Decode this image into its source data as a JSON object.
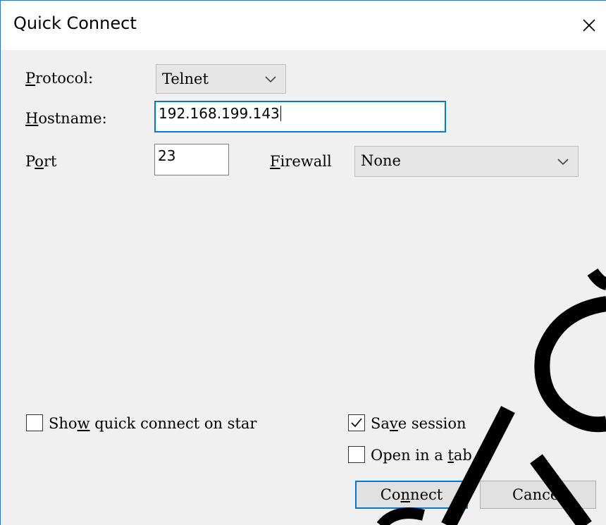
{
  "window": {
    "title": "Quick Connect"
  },
  "form": {
    "protocol_label_pre": "",
    "protocol_label_ul": "P",
    "protocol_label_post": "rotocol:",
    "protocol_value": "Telnet",
    "hostname_label_ul": "H",
    "hostname_label_post": "ostname:",
    "hostname_value": "192.168.199.143",
    "port_label_pre": "P",
    "port_label_ul": "o",
    "port_label_post": "rt",
    "port_value": "23",
    "firewall_label_ul": "F",
    "firewall_label_post": "irewall",
    "firewall_value": "None"
  },
  "options": {
    "show_quick_connect_pre": "Sho",
    "show_quick_connect_ul": "w",
    "show_quick_connect_post": " quick connect on star",
    "show_quick_connect_checked": false,
    "save_session_pre": "Sa",
    "save_session_ul": "v",
    "save_session_post": "e session",
    "save_session_checked": true,
    "open_in_tab_pre": "Open in a ",
    "open_in_tab_ul": "t",
    "open_in_tab_post": "ab",
    "open_in_tab_checked": false
  },
  "buttons": {
    "connect_pre": "Co",
    "connect_ul": "n",
    "connect_post": "nect",
    "cancel": "Cancel"
  },
  "colors": {
    "accent": "#0078d7",
    "dialog_bg": "#f0f0f0"
  },
  "icons": {
    "close": "close-icon",
    "dropdown": "chevron-down-icon",
    "check": "checkmark-icon"
  }
}
